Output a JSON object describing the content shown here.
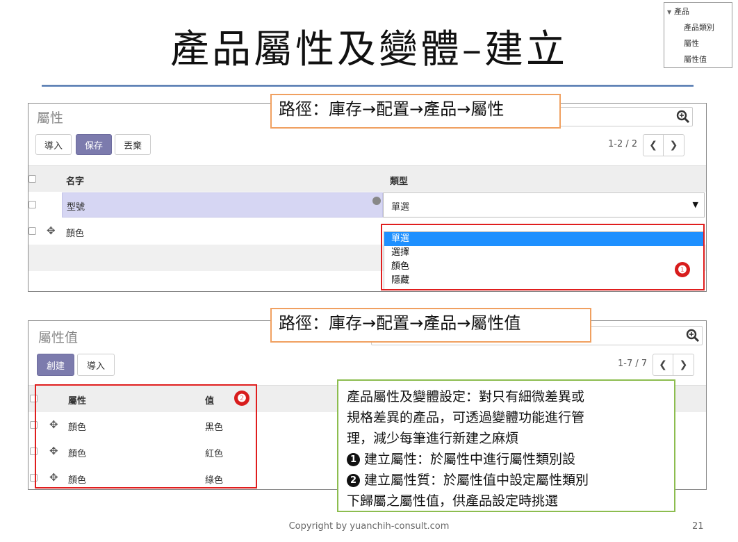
{
  "slide": {
    "title": "產品屬性及變體–建立",
    "copyright": "Copyright by yuanchih-consult.com",
    "page_number": "21"
  },
  "corner_menu": {
    "header": "產品",
    "items": [
      "產品類別",
      "屬性",
      "屬性值"
    ]
  },
  "attributes_panel": {
    "path": "路徑：庫存→配置→產品→屬性",
    "header": "屬性",
    "buttons": {
      "import": "導入",
      "save": "保存",
      "discard": "丟棄"
    },
    "pager": "1-2 / 2",
    "columns": {
      "name": "名字",
      "type": "類型"
    },
    "editing_row": {
      "name": "型號",
      "type": "單選"
    },
    "rows": [
      {
        "name": "顏色"
      }
    ],
    "dropdown_options": [
      "單選",
      "選擇",
      "顏色",
      "隱藏"
    ],
    "dropdown_selected": "單選",
    "badge": "❶"
  },
  "values_panel": {
    "path": "路徑：庫存→配置→產品→屬性值",
    "header": "屬性值",
    "buttons": {
      "create": "創建",
      "import": "導入"
    },
    "pager": "1-7 / 7",
    "columns": {
      "attribute": "屬性",
      "value": "值"
    },
    "rows": [
      {
        "attribute": "顏色",
        "value": "黑色"
      },
      {
        "attribute": "顏色",
        "value": "紅色"
      },
      {
        "attribute": "顏色",
        "value": "綠色"
      }
    ],
    "badge": "❷"
  },
  "note": {
    "lines": [
      "產品屬性及變體設定：對只有細微差異或",
      "規格差異的產品，可透過變體功能進行管",
      "理，減少每筆進行新建之麻煩"
    ],
    "step1_num": "1",
    "step1": "建立屬性：於屬性中進行屬性類別設",
    "step2_num": "2",
    "step2_a": "建立屬性質：於屬性值中設定屬性類別",
    "step2_b": "下歸屬之屬性值，供產品設定時挑選"
  },
  "colors": {
    "primary_button": "#7c7bad",
    "highlight_option": "#1e90ff",
    "edit_row": "#d6d6f3",
    "callout_red": "#e01e1e",
    "path_border": "#f0a060",
    "note_border": "#8cbd4f"
  },
  "icons": [
    "search-icon",
    "chevron-left-icon",
    "chevron-right-icon",
    "drag-handle-icon",
    "globe-icon",
    "caret-down-icon"
  ]
}
